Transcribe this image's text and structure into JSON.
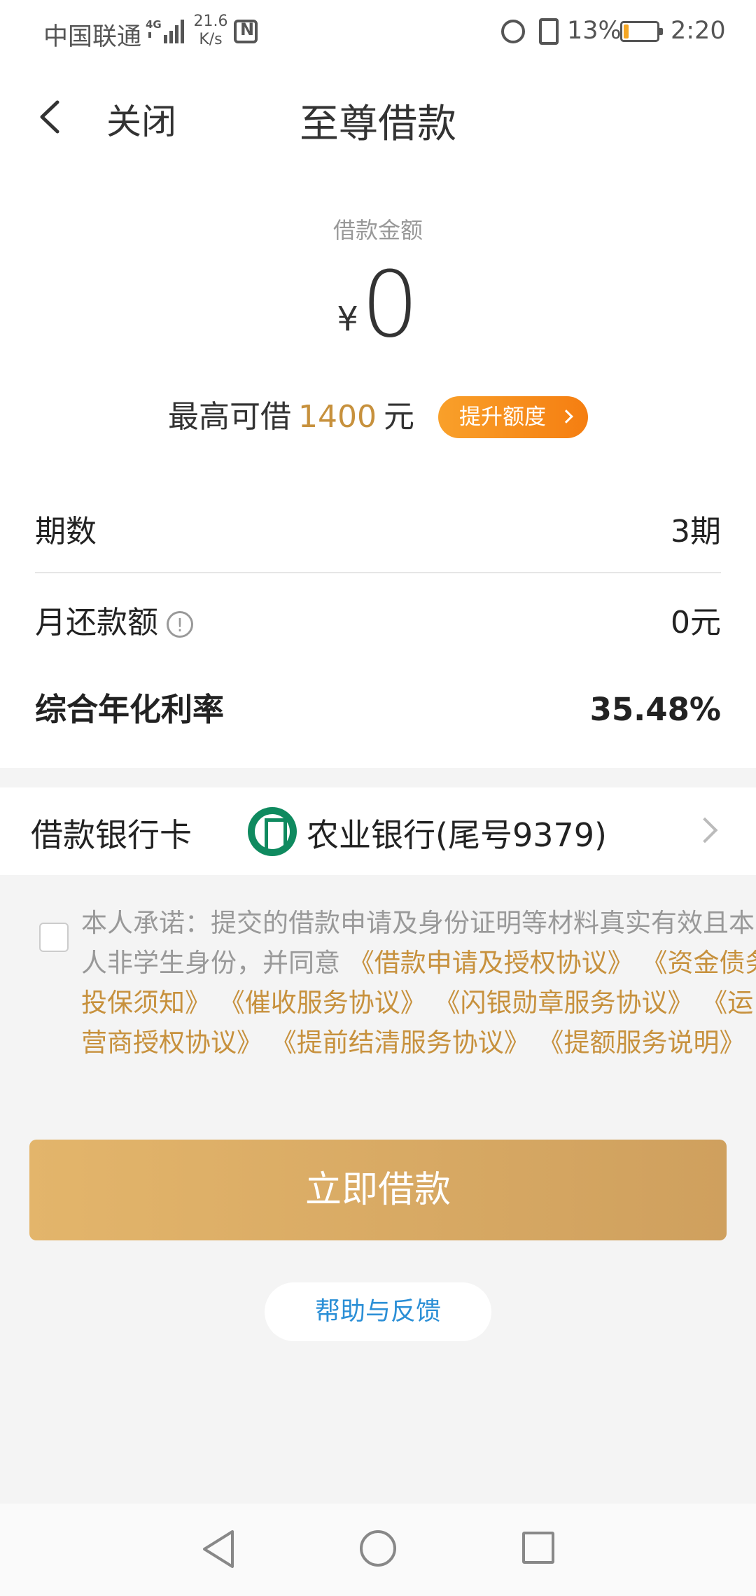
{
  "status_bar": {
    "carrier": "中国联通",
    "network_type": "4G",
    "speed_value": "21.6",
    "speed_unit": "K/s",
    "battery_percent": "13%",
    "battery_level": 0.13,
    "time": "2:20"
  },
  "header": {
    "close_label": "关闭",
    "title": "至尊借款"
  },
  "amount": {
    "label": "借款金额",
    "currency_symbol": "¥",
    "value": "0"
  },
  "limit": {
    "prefix": "最高可借",
    "max_value": "1400",
    "unit": "元",
    "raise_button_label": "提升额度"
  },
  "details": {
    "periods_label": "期数",
    "periods_value": "3期",
    "monthly_label": "月还款额",
    "monthly_value": "0元",
    "rate_label": "综合年化利率",
    "rate_value": "35.48%"
  },
  "bank": {
    "label": "借款银行卡",
    "name": "农业银行(尾号9379)",
    "logo_icon": "abc-bank-logo-icon"
  },
  "agreement": {
    "text_prefix": "本人承诺：提交的借款申请及身份证明等材料真实有效且本人非学生身份，并同意",
    "links": [
      "《借款申请及授权协议》",
      "《资金债务投保须知》",
      "《催收服务协议》",
      "《闪银勋章服务协议》",
      "《运营商授权协议》",
      "《提前结清服务协议》",
      "《提额服务说明》"
    ]
  },
  "submit_label": "立即借款",
  "help_label": "帮助与反馈",
  "colors": {
    "accent_gold": "#c7913d",
    "button_gradient_start": "#e3b56b",
    "button_gradient_end": "#cfa05e",
    "raise_orange": "#f57e11",
    "help_blue": "#2b8fd6",
    "bank_green": "#0f8a5f"
  }
}
